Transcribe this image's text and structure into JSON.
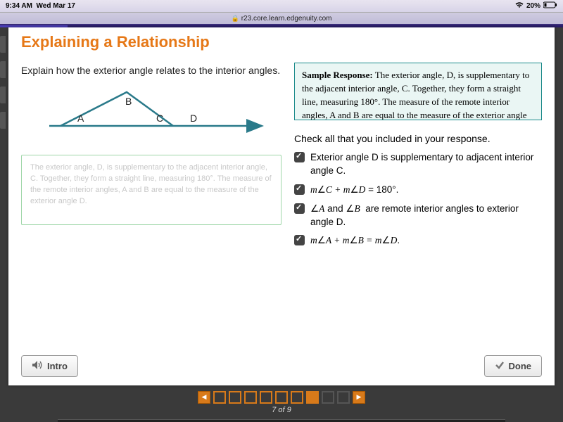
{
  "status": {
    "time": "9:34 AM",
    "date": "Wed Mar 17",
    "battery": "20%"
  },
  "url": "r23.core.learn.edgenuity.com",
  "page": {
    "title": "Explaining a Relationship",
    "question": "Explain how the exterior angle relates to the interior angles.",
    "diagram_labels": {
      "A": "A",
      "B": "B",
      "C": "C",
      "D": "D"
    },
    "student_response_placeholder": "The exterior angle, D, is supplementary to the adjacent interior angle, C. Together, they form a straight line, measuring 180°. The measure of the remote interior angles, A and B are equal to the measure of the exterior angle D.",
    "sample_label": "Sample Response:",
    "sample_text": " The exterior angle, D, is supplementary to the adjacent interior angle, C. Together, they form a straight line, measuring 180°. The measure of the remote interior angles, A and B are equal to the measure of the exterior angle D.",
    "check_prompt": "Check all that you included in your response.",
    "checks": [
      "Exterior angle D is supplementary to adjacent interior angle C.",
      "m∠C + m∠D = 180°.",
      "∠A and ∠B  are remote interior angles to exterior angle D.",
      "m∠A + m∠B = m∠D."
    ],
    "intro_label": "Intro",
    "done_label": "Done"
  },
  "pager": {
    "current": 7,
    "total": 9,
    "text": "7 of 9"
  }
}
